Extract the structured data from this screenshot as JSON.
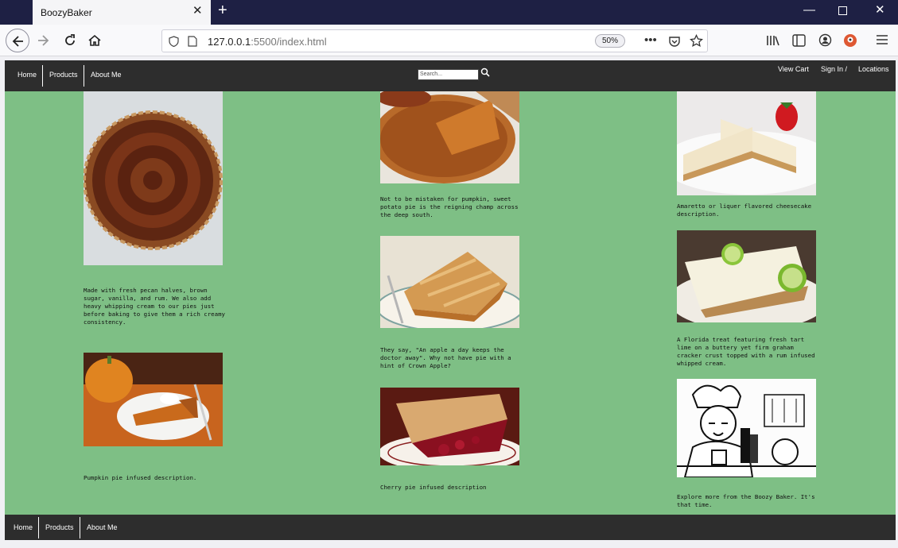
{
  "browser": {
    "tab_title": "BoozyBaker",
    "url_host": "127.0.0.1",
    "url_rest": ":5500/index.html",
    "zoom": "50%"
  },
  "header": {
    "nav": [
      "Home",
      "Products",
      "About Me"
    ],
    "search_placeholder": "Search...",
    "right_links": [
      "View Cart",
      "Sign In /",
      "Locations"
    ]
  },
  "columns": {
    "left": [
      {
        "image": "pecan-pie",
        "desc": "Made with fresh pecan halves, brown sugar, vanilla, and rum. We also add heavy whipping cream to our pies just before baking to give them a rich creamy consistency."
      },
      {
        "image": "pumpkin-pie",
        "desc": "Pumpkin pie infused description."
      }
    ],
    "middle": [
      {
        "image": "sweet-potato-pie",
        "desc": "Not to be mistaken for pumpkin, sweet potato pie is the reigning champ across the deep south."
      },
      {
        "image": "apple-pie",
        "desc": "They say, \"An apple a day keeps the doctor away\". Why not have pie with a hint of Crown Apple?"
      },
      {
        "image": "cherry-pie",
        "desc": "Cherry pie infused description"
      }
    ],
    "right": [
      {
        "image": "cheesecake",
        "desc": "Amaretto or liquer flavored cheesecake description."
      },
      {
        "image": "key-lime-pie",
        "desc": "A Florida treat featuring fresh tart lime on a buttery yet firm graham cracker crust topped with a rum infused whipped cream."
      },
      {
        "image": "boozy-baker-cartoon",
        "desc": "Explore more from the Boozy Baker. It's that time."
      }
    ]
  },
  "footer": {
    "nav": [
      "Home",
      "Products",
      "About Me"
    ]
  }
}
